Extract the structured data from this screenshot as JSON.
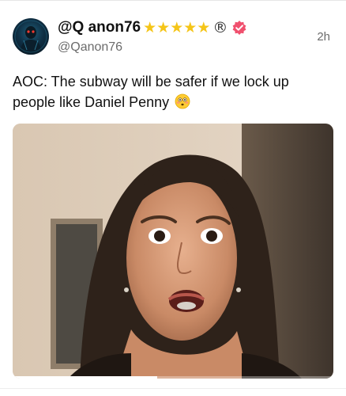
{
  "post": {
    "display_name": "@Q anon76",
    "handle": "@Qanon76",
    "timestamp": "2h",
    "text": "AOC: The subway will be safer if we lock up people like Daniel Penny",
    "star_count": 5,
    "registered_symbol": "®",
    "verified_color": "#f0506e"
  },
  "icons": {
    "avatar": "avatar-glowing-figure",
    "stars": "star-icon",
    "registered": "registered-trademark-icon",
    "verified": "verified-badge-icon",
    "emoji": "flushed-face-emoji"
  },
  "media": {
    "progress": 0.45
  }
}
